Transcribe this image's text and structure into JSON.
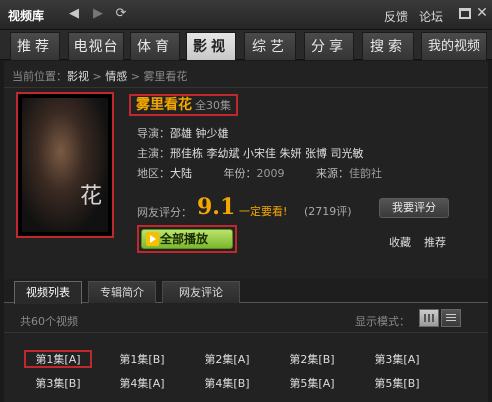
{
  "app": {
    "title": "视频库",
    "feedback": "反馈",
    "forum": "论坛"
  },
  "nav": {
    "tabs": [
      "推荐",
      "电视台",
      "体育",
      "影视",
      "综艺",
      "分享",
      "搜索",
      "我的视频"
    ],
    "active": "影视"
  },
  "breadcrumb": {
    "label": "当前位置：",
    "level1": "影视",
    "sep1": " > ",
    "level2": "情感",
    "sep2": " > ",
    "current": "雾里看花"
  },
  "show": {
    "title": "雾里看花",
    "episodes": "全30集",
    "poster_text": "花",
    "director_label": "导演：",
    "director": "邵雄 钟少雄",
    "cast_label": "主演：",
    "cast": "邢佳栋 李幼斌 小宋佳 朱妍 张博 司光敏",
    "region_label": "地区：",
    "region": "大陆",
    "year_label": "年份：",
    "year": "2009",
    "source_label": "来源：",
    "source": "佳韵社"
  },
  "rating": {
    "label": "网友评分：",
    "score": "9.1",
    "comment": "一定要看!",
    "count": "(2719评)",
    "rate_button": "我要评分"
  },
  "actions": {
    "play_all": "全部播放",
    "collect": "收藏",
    "recommend": "推荐"
  },
  "subtabs": [
    "视频列表",
    "专辑简介",
    "网友评论"
  ],
  "list": {
    "total": "共60个视频",
    "display_mode": "显示模式：",
    "episodes": [
      "第1集[A]",
      "第1集[B]",
      "第2集[A]",
      "第2集[B]",
      "第3集[A]",
      "第3集[B]",
      "第4集[A]",
      "第4集[B]",
      "第5集[A]",
      "第5集[B]"
    ]
  },
  "colors": {
    "accent": "#f5a700",
    "highlight_border": "#c0282e",
    "play_green": "#7bb82c"
  }
}
